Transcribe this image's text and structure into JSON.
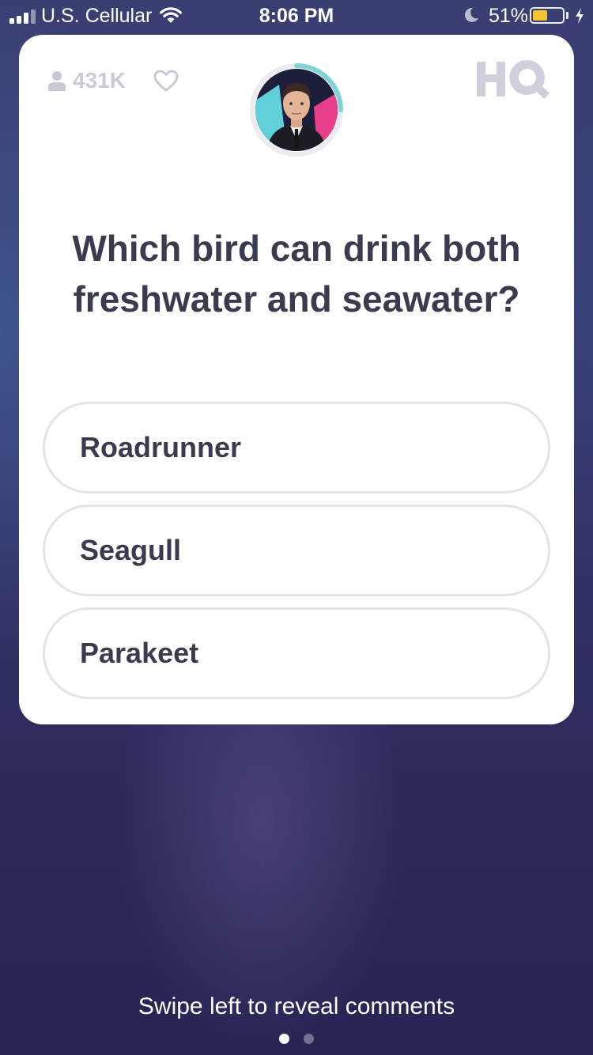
{
  "status_bar": {
    "carrier": "U.S. Cellular",
    "time": "8:06 PM",
    "battery_percent_text": "51%",
    "battery_level": 0.51,
    "battery_color": "#f4c430",
    "icons": [
      "signal-icon",
      "wifi-icon",
      "moon-icon",
      "battery-icon",
      "charging-bolt-icon"
    ]
  },
  "card": {
    "viewer_count": "431K",
    "icons": [
      "person-icon",
      "heart-icon",
      "host-avatar",
      "hq-logo"
    ],
    "timer_progress": 0.25,
    "timer_color": "#7fd3d6",
    "question": "Which bird can drink both freshwater and seawater?",
    "answers": [
      {
        "label": "Roadrunner"
      },
      {
        "label": "Seagull"
      },
      {
        "label": "Parakeet"
      }
    ]
  },
  "footer": {
    "swipe_hint": "Swipe left to reveal comments",
    "pages": 2,
    "active_page": 1
  }
}
